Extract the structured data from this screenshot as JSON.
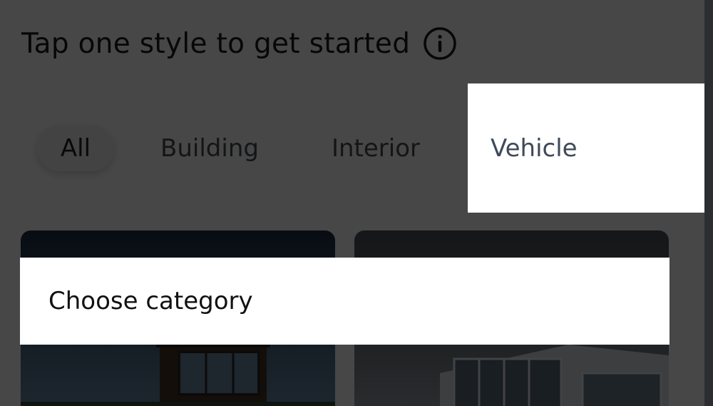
{
  "header": {
    "title": "Tap one style to get started",
    "info_icon": "info-circle-icon"
  },
  "tabs": [
    {
      "label": "All",
      "selected": true
    },
    {
      "label": "Building",
      "selected": false
    },
    {
      "label": "Interior",
      "selected": false
    },
    {
      "label": "Vehicle",
      "selected": false,
      "highlighted": true
    }
  ],
  "cards": [
    {
      "image": "architecture-cabin-thumbnail"
    },
    {
      "image": "modern-building-thumbnail"
    }
  ],
  "onboarding": {
    "tooltip_text": "Choose category"
  }
}
